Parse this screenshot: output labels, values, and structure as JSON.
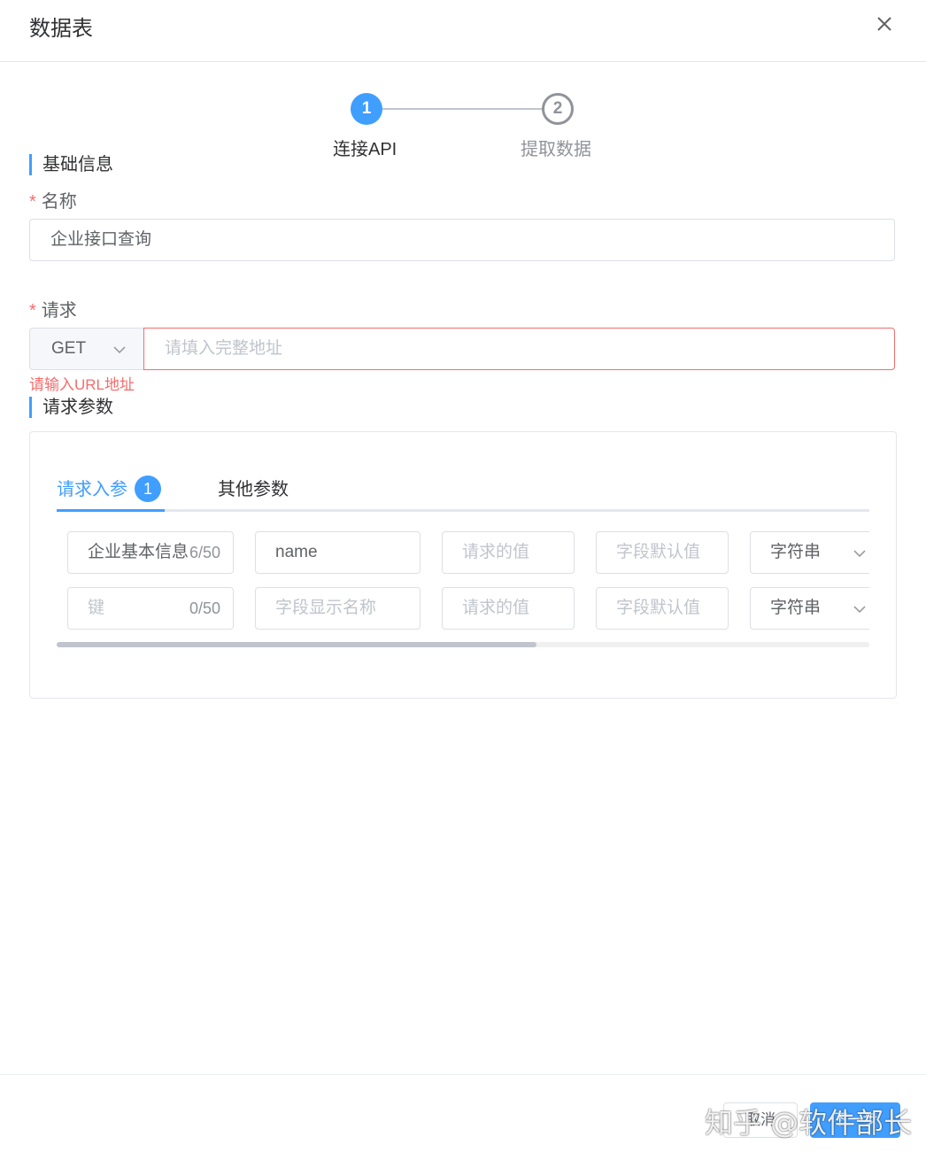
{
  "dialog": {
    "title": "数据表"
  },
  "steps": [
    {
      "number": "1",
      "label": "连接API",
      "active": true
    },
    {
      "number": "2",
      "label": "提取数据",
      "active": false
    }
  ],
  "basic_info": {
    "section_title": "基础信息",
    "name_label": "名称",
    "name_value": "企业接口查询",
    "request_label": "请求",
    "method_value": "GET",
    "url_placeholder": "请填入完整地址",
    "url_error": "请输入URL地址"
  },
  "params": {
    "section_title": "请求参数",
    "tabs": [
      {
        "label": "请求入参",
        "badge": "1"
      },
      {
        "label": "其他参数"
      }
    ],
    "rows": [
      {
        "key": "企业基本信息",
        "key_count": "6/50",
        "display_name": "name",
        "value_placeholder": "请求的值",
        "default_placeholder": "字段默认值",
        "type": "字符串"
      },
      {
        "key_placeholder": "键",
        "key_count": "0/50",
        "display_placeholder": "字段显示名称",
        "value_placeholder": "请求的值",
        "default_placeholder": "字段默认值",
        "type": "字符串"
      }
    ],
    "scroll_fraction": 0.59
  },
  "footer": {
    "cancel_label": "取消",
    "next_label": "下一步"
  },
  "watermark": "知乎 @软件部长",
  "colors": {
    "primary": "#409eff",
    "danger": "#f56c6c",
    "border": "#dcdfe6"
  }
}
